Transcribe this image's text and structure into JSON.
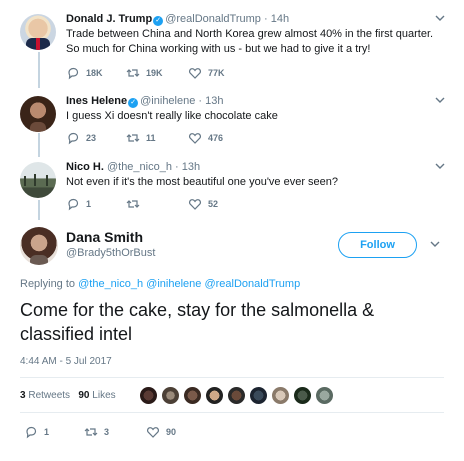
{
  "replies": [
    {
      "name": "Donald J. Trump",
      "verified": true,
      "handle": "@realDonaldTrump",
      "time": "· 14h",
      "text": "Trade between China and North Korea grew almost 40% in the first quarter. So much for China working with us - but we had to give it a try!",
      "reply_count": "18K",
      "retweet_count": "19K",
      "like_count": "77K"
    },
    {
      "name": "Ines Helene",
      "verified": true,
      "handle": "@inihelene",
      "time": "· 13h",
      "text": "I guess Xi doesn't really like chocolate cake",
      "reply_count": "23",
      "retweet_count": "11",
      "like_count": "476"
    },
    {
      "name": "Nico H.",
      "verified": false,
      "handle": "@the_nico_h",
      "time": "· 13h",
      "text": "Not even if it's the most beautiful one you've ever seen?",
      "reply_count": "1",
      "retweet_count": "",
      "like_count": "52"
    }
  ],
  "main": {
    "name": "Dana Smith",
    "handle": "@Brady5thOrBust",
    "follow_label": "Follow",
    "replying_prefix": "Replying to",
    "replying_to": [
      "@the_nico_h",
      "@inihelene",
      "@realDonaldTrump"
    ],
    "text": "Come for the cake, stay for the salmonella & classified intel",
    "timestamp": "4:44 AM - 5 Jul 2017",
    "retweets_count": "3",
    "retweets_label": "Retweets",
    "likes_count": "90",
    "likes_label": "Likes",
    "reply_count": "1",
    "retweet_count": "3",
    "like_count": "90"
  },
  "colors": {
    "accent": "#1da1f2",
    "muted": "#657786",
    "text": "#14171a",
    "thread_line": "#c4d4e0"
  },
  "icons": [
    "verified-badge-icon",
    "chevron-down-icon",
    "reply-icon",
    "retweet-icon",
    "like-icon"
  ]
}
